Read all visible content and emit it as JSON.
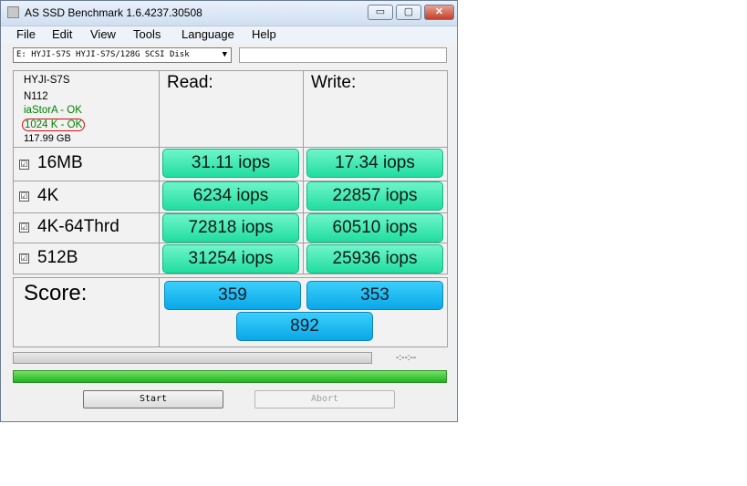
{
  "window": {
    "title": "AS SSD Benchmark 1.6.4237.30508",
    "minimize": "▭",
    "maximize": "▢",
    "close": "✕"
  },
  "menu": [
    "File",
    "Edit",
    "View",
    "Tools",
    "Language",
    "Help"
  ],
  "drive_select": {
    "value": "E: HYJI-S7S HYJI-S7S/128G SCSI Disk",
    "arrow": "▼"
  },
  "info": {
    "name": "HYJI-S7S",
    "firmware": "N112",
    "driver": "iaStorA - OK",
    "alignment": "1024 K - OK",
    "size": "117.99 GB",
    "ok_color": "#008000",
    "highlight_color": "#d01010"
  },
  "headers": {
    "read": "Read:",
    "write": "Write:"
  },
  "tests": [
    {
      "label": "16MB",
      "checked": "☑",
      "read": "31.11 iops",
      "write": "17.34 iops"
    },
    {
      "label": "4K",
      "checked": "☑",
      "read": "6234 iops",
      "write": "22857 iops"
    },
    {
      "label": "4K-64Thrd",
      "checked": "☑",
      "read": "72818 iops",
      "write": "60510 iops"
    },
    {
      "label": "512B",
      "checked": "☑",
      "read": "31254 iops",
      "write": "25936 iops"
    }
  ],
  "score": {
    "label": "Score:",
    "read": "359",
    "write": "353",
    "total": "892"
  },
  "progress": {
    "eta": "-:--:--",
    "bar1_fill": 0,
    "bar2_fill": 1.0
  },
  "buttons": {
    "start": "Start",
    "abort": "Abort"
  },
  "colors": {
    "result_green": "#20dda0",
    "score_blue": "#0aa7e8",
    "progress_green": "#1db51a"
  }
}
